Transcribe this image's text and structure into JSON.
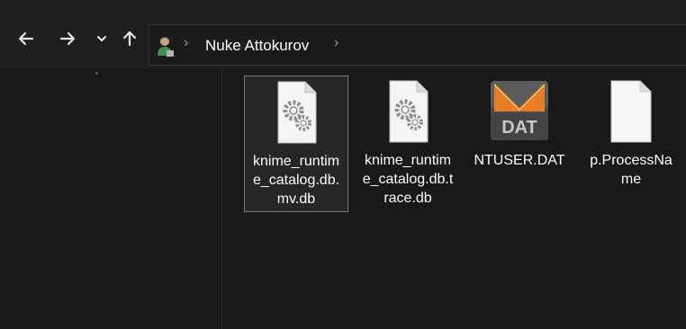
{
  "navigation": {
    "back_icon": "arrow-left-icon",
    "forward_icon": "arrow-right-icon",
    "recent_icon": "chevron-down-icon",
    "up_icon": "arrow-up-icon"
  },
  "address_bar": {
    "location_icon": "user-folder-icon",
    "breadcrumb": "Nuke Attokurov",
    "separator_icon": "chevron-right-icon"
  },
  "files": [
    {
      "name": "knime_runtime_catalog.db.mv.db",
      "icon": "gear-file-icon",
      "selected": true
    },
    {
      "name": "knime_runtime_catalog.db.trace.db",
      "icon": "gear-file-icon",
      "selected": false
    },
    {
      "name": "NTUSER.DAT",
      "icon": "dat-file-icon",
      "icon_text": "DAT",
      "selected": false
    },
    {
      "name": "p.ProcessName",
      "icon": "blank-file-icon",
      "selected": false
    }
  ]
}
